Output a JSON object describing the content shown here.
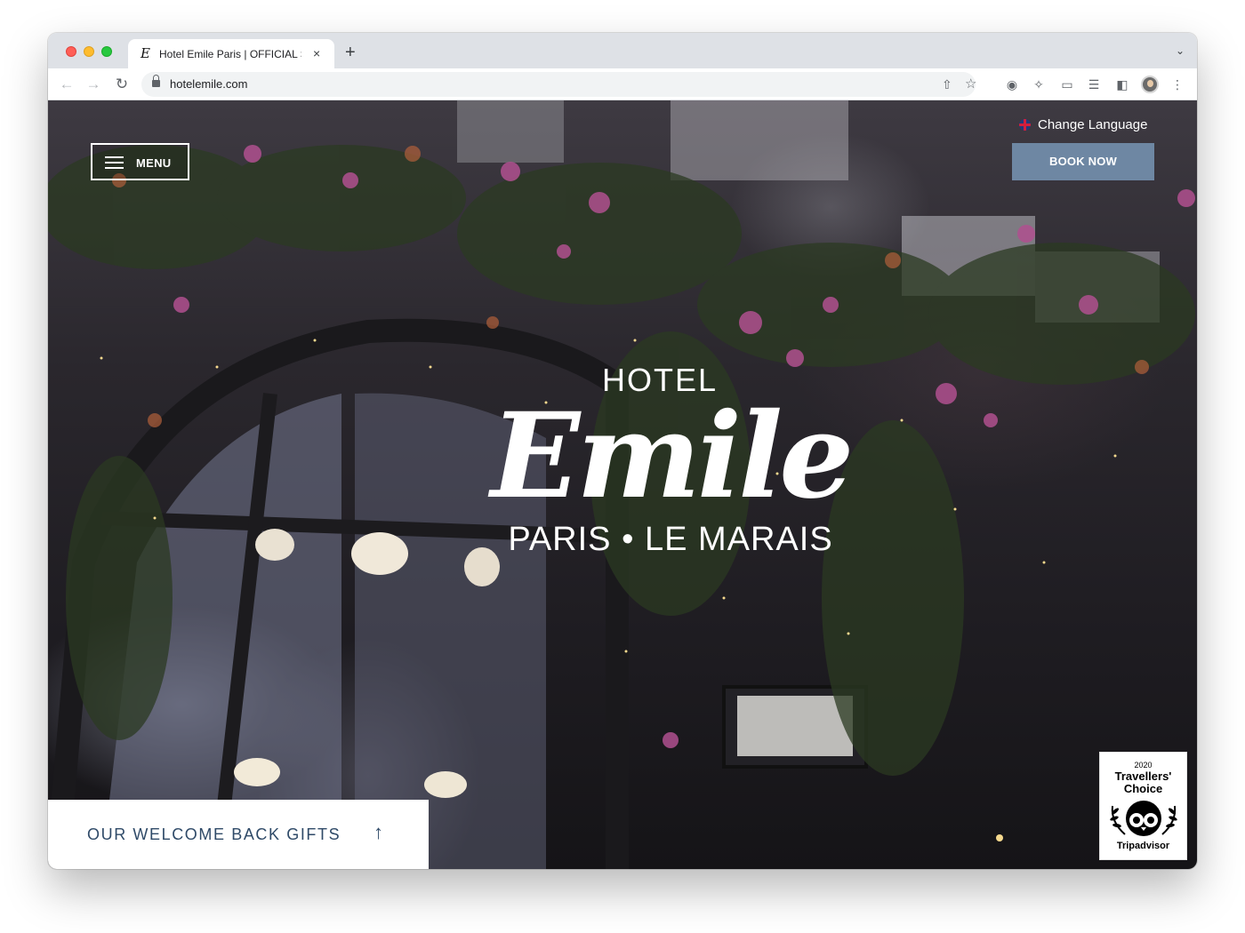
{
  "browser": {
    "tab_title": "Hotel Emile Paris | OFFICIAL SITE",
    "favicon_glyph": "E",
    "new_tab": "+",
    "close": "×",
    "url": "hotelemile.com"
  },
  "header": {
    "menu_label": "MENU",
    "language_label": "Change Language",
    "book_label": "BOOK NOW"
  },
  "logo": {
    "line1": "HOTEL",
    "line2": "Emile",
    "line3": "PARIS  •  LE MARAIS"
  },
  "gifts": {
    "label": "OUR WELCOME BACK GIFTS",
    "arrow": "↑"
  },
  "badge": {
    "year": "2020",
    "title_line1": "Travellers'",
    "title_line2": "Choice",
    "brand": "Tripadvisor"
  },
  "colors": {
    "book_button": "#6e87a3",
    "gifts_text": "#2f4a68"
  },
  "icons": [
    "arrow-left-icon",
    "arrow-right-icon",
    "reload-icon",
    "lock-icon",
    "share-icon",
    "star-icon",
    "extension-icon",
    "puzzle-icon",
    "cast-icon",
    "media-icon",
    "sidebar-icon",
    "menu-dots-icon",
    "hamburger-icon",
    "flag-uk-icon",
    "arrow-up-icon",
    "tripadvisor-owl-icon"
  ]
}
